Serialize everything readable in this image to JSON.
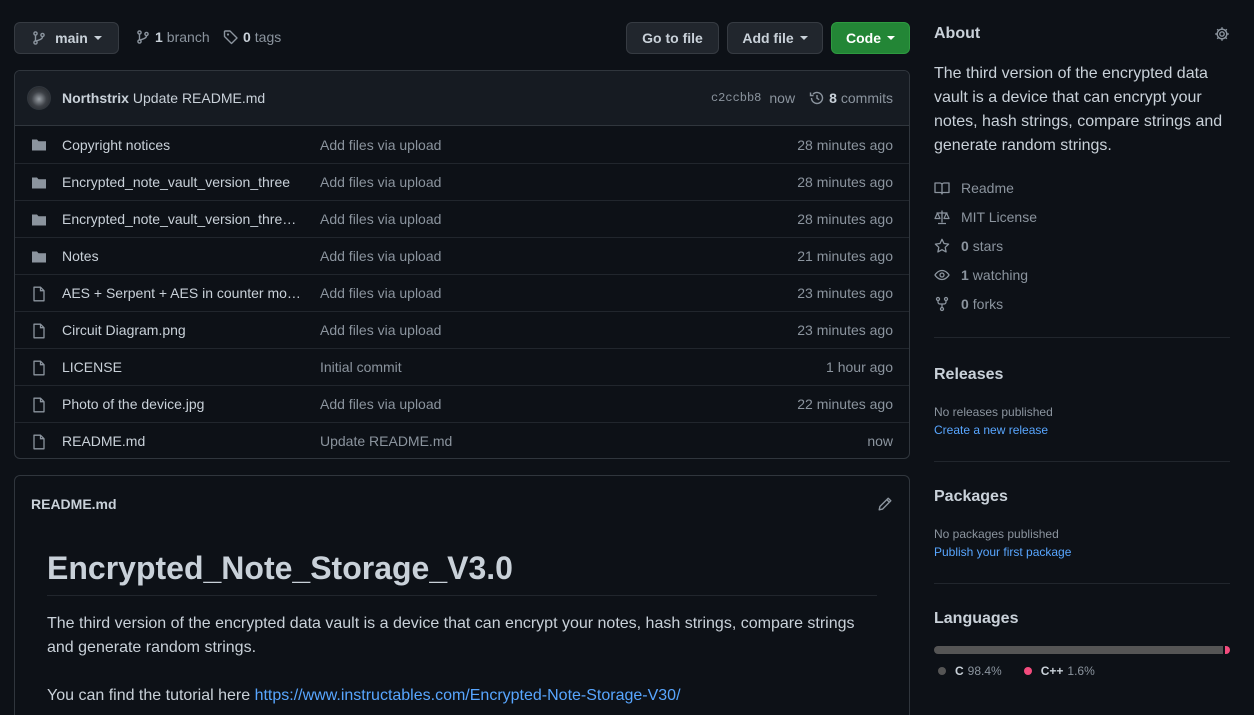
{
  "toolbar": {
    "branch_label": "main",
    "branches_count": "1",
    "branches_label": "branch",
    "tags_count": "0",
    "tags_label": "tags",
    "go_to_file": "Go to file",
    "add_file": "Add file",
    "code": "Code"
  },
  "commit": {
    "author": "Northstrix",
    "message": "Update README.md",
    "sha": "c2ccbb8",
    "time": "now",
    "count": "8",
    "count_label": "commits"
  },
  "files": [
    {
      "type": "dir",
      "name": "Copyright notices",
      "message": "Add files via upload",
      "age": "28 minutes ago"
    },
    {
      "type": "dir",
      "name": "Encrypted_note_vault_version_three",
      "message": "Add files via upload",
      "age": "28 minutes ago"
    },
    {
      "type": "dir",
      "name": "Encrypted_note_vault_version_three_...",
      "message": "Add files via upload",
      "age": "28 minutes ago"
    },
    {
      "type": "dir",
      "name": "Notes",
      "message": "Add files via upload",
      "age": "21 minutes ago"
    },
    {
      "type": "file",
      "name": "AES + Serpent + AES in counter mod...",
      "message": "Add files via upload",
      "age": "23 minutes ago"
    },
    {
      "type": "file",
      "name": "Circuit Diagram.png",
      "message": "Add files via upload",
      "age": "23 minutes ago"
    },
    {
      "type": "file",
      "name": "LICENSE",
      "message": "Initial commit",
      "age": "1 hour ago"
    },
    {
      "type": "file",
      "name": "Photo of the device.jpg",
      "message": "Add files via upload",
      "age": "22 minutes ago"
    },
    {
      "type": "file",
      "name": "README.md",
      "message": "Update README.md",
      "age": "now"
    }
  ],
  "readme": {
    "filename": "README.md",
    "heading": "Encrypted_Note_Storage_V3.0",
    "paragraph": "The third version of the encrypted data vault is a device that can encrypt your notes, hash strings, compare strings and generate random strings.",
    "tutorial_prefix": "You can find the tutorial here ",
    "tutorial_link": "https://www.instructables.com/Encrypted-Note-Storage-V30/"
  },
  "about": {
    "title": "About",
    "description": "The third version of the encrypted data vault is a device that can encrypt your notes, hash strings, compare strings and generate random strings.",
    "readme": "Readme",
    "license": "MIT License",
    "stars_count": "0",
    "stars_label": "stars",
    "watching_count": "1",
    "watching_label": "watching",
    "forks_count": "0",
    "forks_label": "forks"
  },
  "releases": {
    "title": "Releases",
    "none": "No releases published",
    "create_link": "Create a new release"
  },
  "packages": {
    "title": "Packages",
    "none": "No packages published",
    "publish_link": "Publish your first package"
  },
  "languages": {
    "title": "Languages",
    "items": [
      {
        "name": "C",
        "percent": "98.4%",
        "value": 98.4,
        "color": "#555555"
      },
      {
        "name": "C++",
        "percent": "1.6%",
        "value": 1.6,
        "color": "#f34b7d"
      }
    ]
  }
}
